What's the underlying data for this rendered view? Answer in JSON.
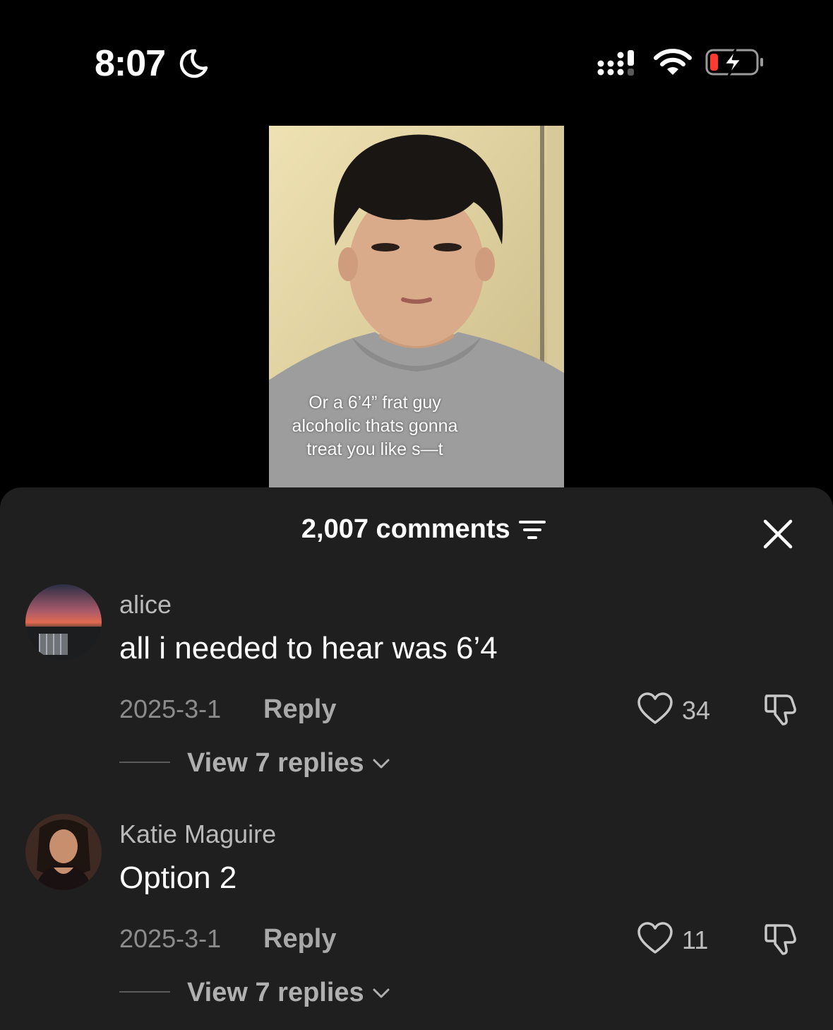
{
  "status_bar": {
    "time": "8:07",
    "icons": [
      "moon-icon",
      "cellular-signal-icon",
      "wifi-icon",
      "battery-charging-icon"
    ],
    "battery_color": "#ff3b30"
  },
  "video": {
    "caption": "Or a 6’4” frat guy\nalcoholic thats gonna\ntreat you like s—t"
  },
  "comments_sheet": {
    "count_label": "2,007 comments",
    "icons": [
      "sort-icon",
      "close-icon"
    ],
    "comments": [
      {
        "username": "alice",
        "text": "all i needed to hear was 6’4",
        "date": "2025-3-1",
        "reply_label": "Reply",
        "likes": "34",
        "view_replies": "View 7 replies"
      },
      {
        "username": "Katie Maguire",
        "text": "Option 2",
        "date": "2025-3-1",
        "reply_label": "Reply",
        "likes": "11",
        "view_replies": "View 7 replies"
      }
    ]
  },
  "colors": {
    "background": "#000000",
    "sheet": "#1f1f1f",
    "secondary_text": "#8c8c8c"
  }
}
